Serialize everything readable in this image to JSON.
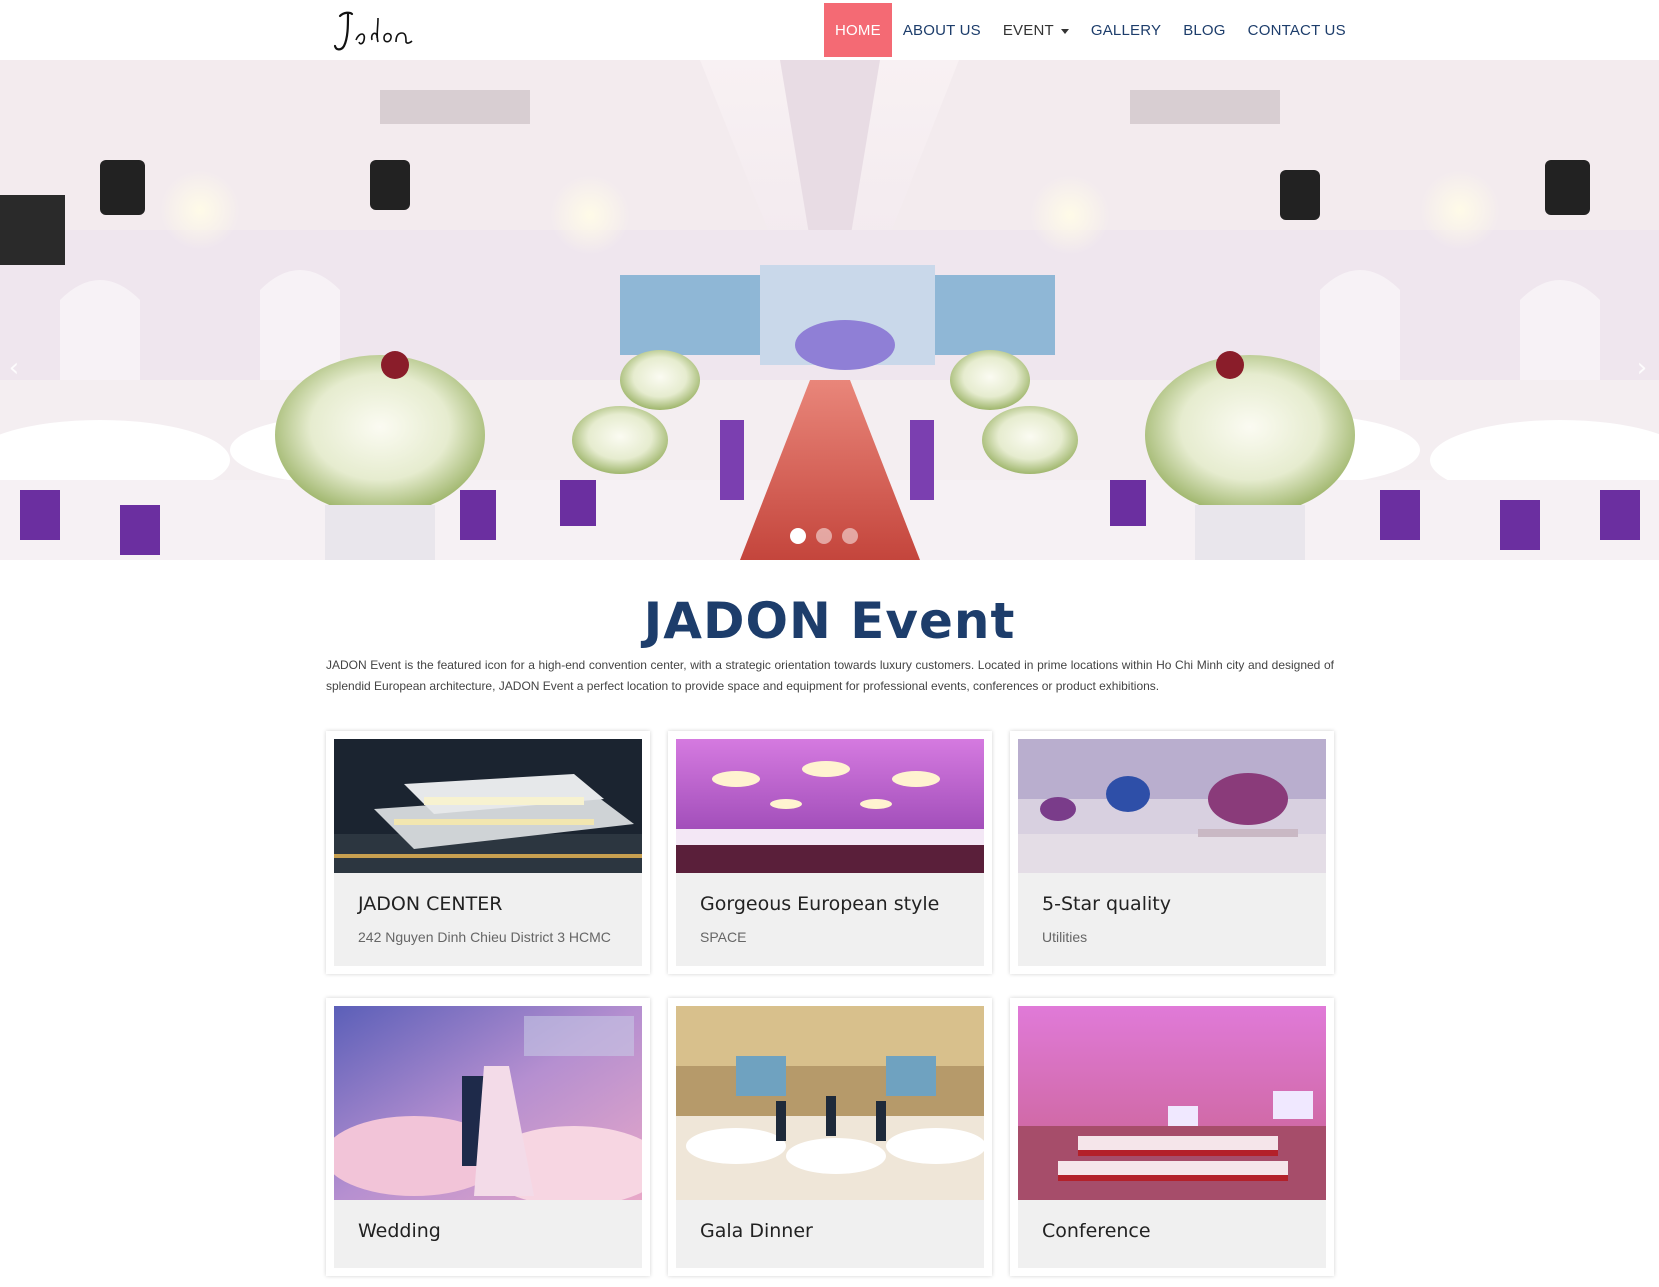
{
  "navbar": {
    "logo_text": "Jadon",
    "items": [
      {
        "label": "HOME",
        "active": true
      },
      {
        "label": "ABOUT US"
      },
      {
        "label": "EVENT",
        "dropdown": true
      },
      {
        "label": "GALLERY"
      },
      {
        "label": "BLOG"
      },
      {
        "label": "CONTACT US"
      }
    ]
  },
  "hero": {
    "prev_icon": "chevron-left-icon",
    "next_icon": "chevron-right-icon",
    "slide_count": 3,
    "active_slide": 1
  },
  "intro": {
    "title": "JADON Event",
    "text": "JADON Event is the featured icon for a high-end convention center, with a strategic orientation towards luxury customers. Located in prime locations within Ho Chi Minh city and designed of splendid European architecture, JADON Event a perfect location to provide space and equipment for professional events, conferences or product exhibitions."
  },
  "features": [
    {
      "title": "JADON CENTER",
      "subtitle": "242 Nguyen Dinh Chieu District 3 HCMC"
    },
    {
      "title": "Gorgeous European style",
      "subtitle": "SPACE"
    },
    {
      "title": "5-Star quality",
      "subtitle": "Utilities"
    }
  ],
  "events": [
    {
      "title": "Wedding"
    },
    {
      "title": "Gala Dinner"
    },
    {
      "title": "Conference"
    }
  ],
  "colors": {
    "brand_navy": "#1d3d6b",
    "active_nav": "#f46a74",
    "card_body": "#f0f0f0"
  }
}
